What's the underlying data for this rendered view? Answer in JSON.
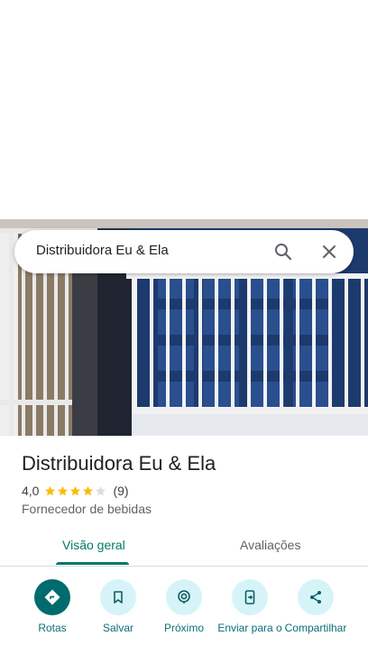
{
  "search": {
    "query": "Distribuidora Eu & Ela"
  },
  "place": {
    "name": "Distribuidora Eu & Ela",
    "rating": "4,0",
    "stars": 4,
    "max_stars": 5,
    "review_count": "(9)",
    "category": "Fornecedor de bebidas"
  },
  "tabs": [
    {
      "label": "Visão geral",
      "active": true
    },
    {
      "label": "Avaliações",
      "active": false
    }
  ],
  "actions": [
    {
      "label": "Rotas",
      "icon": "directions-icon"
    },
    {
      "label": "Salvar",
      "icon": "bookmark-icon"
    },
    {
      "label": "Próximo",
      "icon": "nearby-icon"
    },
    {
      "label": "Enviar para o",
      "icon": "send-to-phone-icon"
    },
    {
      "label": "Compartilhar",
      "icon": "share-icon"
    }
  ],
  "colors": {
    "accent": "#00796b",
    "primary_button": "#006b6e",
    "tonal_button": "#d6f4f8",
    "star": "#fbbc04"
  }
}
